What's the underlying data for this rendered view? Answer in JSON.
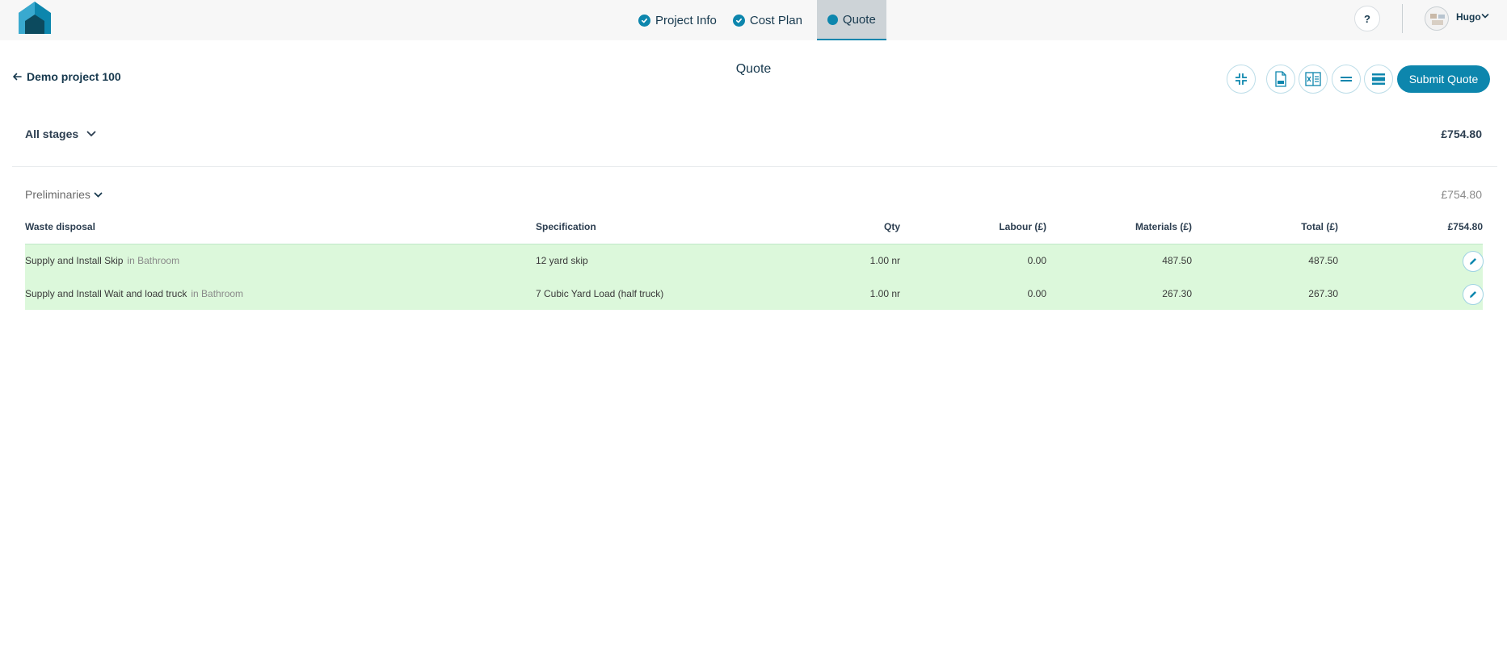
{
  "nav": {
    "tabs": [
      {
        "label": "Project Info",
        "state": "completed"
      },
      {
        "label": "Cost Plan",
        "state": "completed"
      },
      {
        "label": "Quote",
        "state": "active"
      }
    ],
    "help_label": "?",
    "user": {
      "name": "Hugo"
    }
  },
  "header": {
    "back_label": "Demo project 100",
    "title": "Quote",
    "submit_label": "Submit Quote",
    "tools": [
      "collapse-icon",
      "pdf-icon",
      "excel-icon",
      "compact-view-icon",
      "expanded-view-icon"
    ]
  },
  "stages": {
    "selected": "All stages",
    "total": "£754.80"
  },
  "section": {
    "name": "Preliminaries",
    "total": "£754.80"
  },
  "table": {
    "columns": {
      "group": "Waste disposal",
      "specification": "Specification",
      "qty": "Qty",
      "labour": "Labour (£)",
      "materials": "Materials (£)",
      "total": "Total (£)",
      "group_total": "£754.80"
    },
    "rows": [
      {
        "item": "Supply and Install Skip",
        "location": "in Bathroom",
        "specification": "12 yard skip",
        "qty": "1.00 nr",
        "labour": "0.00",
        "materials": "487.50",
        "total": "487.50"
      },
      {
        "item": "Supply and Install Wait and load truck",
        "location": "in Bathroom",
        "specification": "7 Cubic Yard Load (half truck)",
        "qty": "1.00 nr",
        "labour": "0.00",
        "materials": "267.30",
        "total": "267.30"
      }
    ]
  },
  "colors": {
    "accent": "#0d86ad",
    "row_highlight": "#dcf8db",
    "nav_background": "#f7f7f7"
  }
}
